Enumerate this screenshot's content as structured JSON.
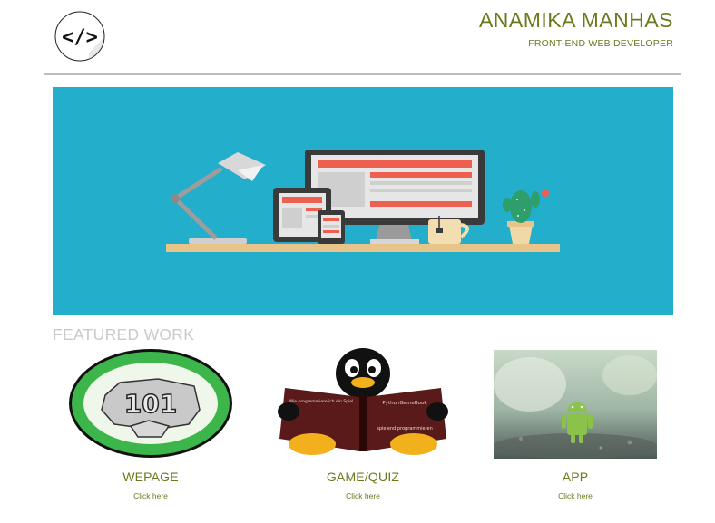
{
  "header": {
    "logo_glyph": "</>",
    "logo_icon": "code-icon",
    "name": "ANAMIKA MANHAS",
    "role": "FRONT-END WEB DEVELOPER"
  },
  "hero": {
    "illustration": "developer-desk-illustration",
    "background_color": "#23aecb"
  },
  "featured": {
    "heading": "FEATURED WORK",
    "items": [
      {
        "title": "WEPAGE",
        "link": "Click here",
        "thumb_text": "101",
        "thumb": "badge-101-icon"
      },
      {
        "title": "GAME/QUIZ",
        "link": "Click here",
        "thumb_text": "PythonGameBook",
        "thumb_text_2": "spielend programmieren",
        "thumb": "penguin-reading-book-image"
      },
      {
        "title": "APP",
        "link": "Click here",
        "thumb": "android-robot-image"
      }
    ]
  },
  "colors": {
    "accent": "#6b7a1f",
    "heading_muted": "#c9c9c9",
    "divider": "#bdbdbd"
  }
}
